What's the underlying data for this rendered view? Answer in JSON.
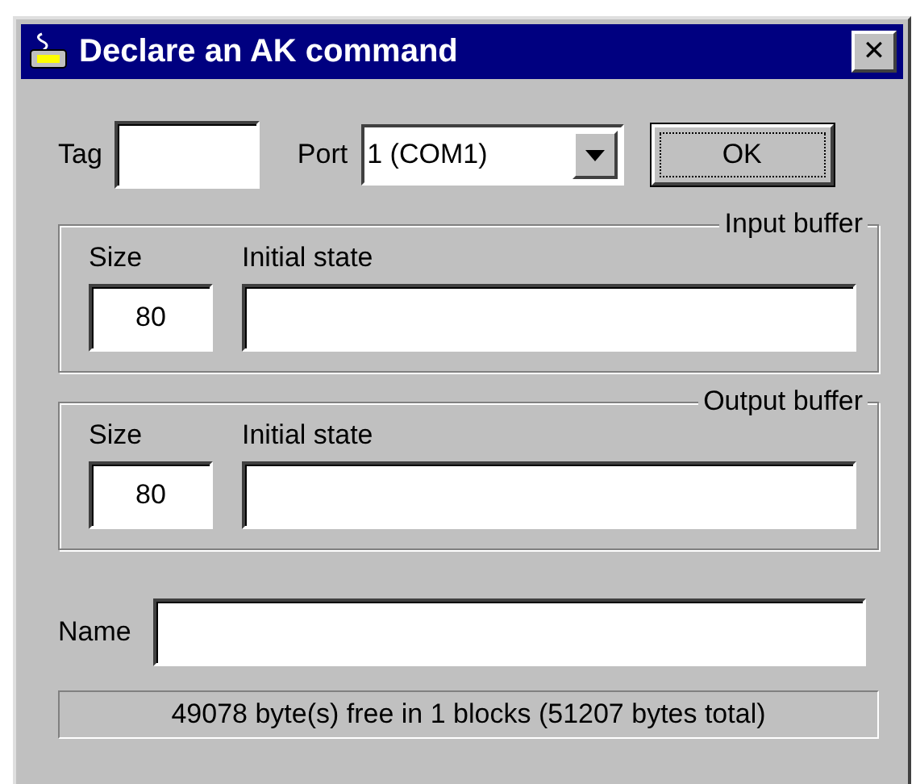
{
  "window": {
    "title": "Declare an AK command",
    "close": "✕"
  },
  "tag": {
    "label": "Tag"
  },
  "port": {
    "label": "Port",
    "value": "1 (COM1)"
  },
  "ok_button": {
    "label": "OK",
    "focused": true
  },
  "groups": [
    {
      "title": "Input buffer",
      "size_label": "Size",
      "size": "80",
      "state_label": "Initial state"
    },
    {
      "title": "Output buffer",
      "size_label": "Size",
      "size": "80",
      "state_label": "Initial state"
    }
  ],
  "name": {
    "label": "Name"
  },
  "status_bar": "49078 byte(s) free in 1 blocks (51207 bytes total)"
}
